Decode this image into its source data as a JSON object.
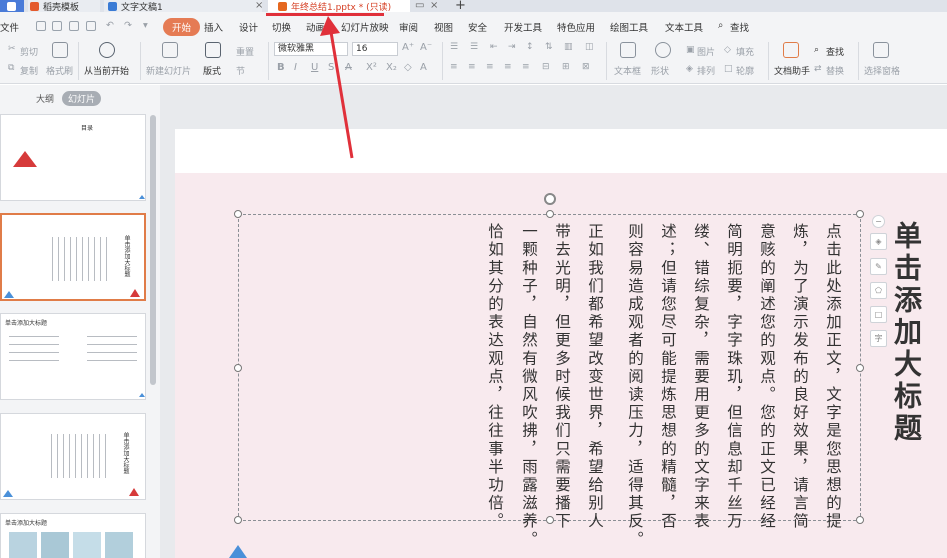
{
  "tabs": [
    {
      "label": "稻壳模板"
    },
    {
      "label": "文字文稿1"
    },
    {
      "label": "年终总结1.pptx * (只读)"
    }
  ],
  "menu": {
    "file": "文件",
    "items": [
      "开始",
      "插入",
      "设计",
      "切换",
      "动画",
      "幻灯片放映",
      "审阅",
      "视图",
      "安全",
      "开发工具",
      "特色应用",
      "绘图工具",
      "文本工具"
    ],
    "search": "查找"
  },
  "ribbon": {
    "cut": "剪切",
    "copy": "复制",
    "format_painter": "格式刷",
    "from_current": "从当前开始",
    "new_slide": "新建幻灯片",
    "layout": "版式",
    "reset": "重置",
    "section": "节",
    "font_name": "微软雅黑",
    "font_size": "16",
    "text_box": "文本框",
    "shape": "形状",
    "arrange": "排列",
    "picture": "图片",
    "fill": "填充",
    "outline": "轮廓",
    "find": "查找",
    "replace": "替换",
    "doc_assistant": "文档助手",
    "select_pane": "选择窗格"
  },
  "left_panel": {
    "outline_tab": "大纲",
    "slides_tab": "幻灯片",
    "thumb1_title": "目录",
    "thumb2_title": "单击添加大标题",
    "thumb3_title": "单击添加大标题",
    "thumb4_title": "单击添加大标题",
    "thumb5_title": "单击添加大标题"
  },
  "slide": {
    "title": "单击添加大标题",
    "columns": [
      "点击此处添加正文，文字是您思想的提",
      "炼，为了演示发布的良好效果，请言简",
      "意赅的阐述您的观点。您的正文已经经",
      "简明扼要，字字珠玑，但信息却千丝万",
      "缕、错综复杂，需要用更多的文字来表",
      "述；但请您尽可能提炼思想的精髓，否",
      "则容易造成观者的阅读压力，适得其反。",
      "正如我们都希望改变世界，希望给别人",
      "带去光明，但更多时候我们只需要播下",
      "一颗种子，自然有微风吹拂，雨露滋养。",
      "恰如其分的表达观点，往往事半功倍。"
    ]
  },
  "colors": {
    "accent": "#e57b54",
    "annotation": "#e0303a",
    "slide_bg": "#f8eaee"
  }
}
